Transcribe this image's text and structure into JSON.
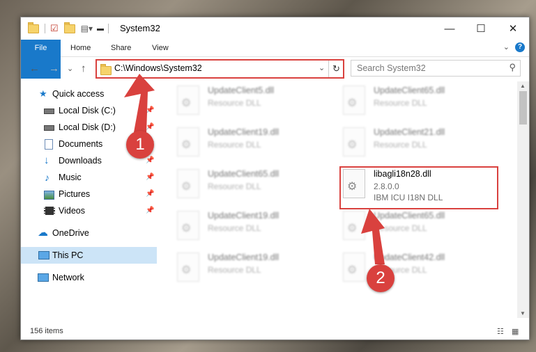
{
  "window": {
    "title": "System32",
    "controls": {
      "minimize": "—",
      "maximize": "☐",
      "close": "✕"
    }
  },
  "ribbon": {
    "tabs": [
      {
        "label": "File"
      },
      {
        "label": "Home"
      },
      {
        "label": "Share"
      },
      {
        "label": "View"
      }
    ],
    "help": "?"
  },
  "nav": {
    "back": "←",
    "forward": "→",
    "recent": "⌄",
    "up": "↑",
    "address": "C:\\Windows\\System32",
    "search_placeholder": "Search System32"
  },
  "sidebar": {
    "items": [
      {
        "label": "Quick access",
        "icon": "star-icon"
      },
      {
        "label": "Local Disk (C:)",
        "icon": "drive-icon",
        "pinned": true
      },
      {
        "label": "Local Disk (D:)",
        "icon": "drive-icon",
        "pinned": true
      },
      {
        "label": "Documents",
        "icon": "documents-icon",
        "pinned": true
      },
      {
        "label": "Downloads",
        "icon": "downloads-icon",
        "pinned": true
      },
      {
        "label": "Music",
        "icon": "music-icon",
        "pinned": true
      },
      {
        "label": "Pictures",
        "icon": "pictures-icon",
        "pinned": true
      },
      {
        "label": "Videos",
        "icon": "videos-icon",
        "pinned": true
      },
      {
        "label": "OneDrive",
        "icon": "onedrive-icon"
      },
      {
        "label": "This PC",
        "icon": "computer-icon",
        "selected": true
      },
      {
        "label": "Network",
        "icon": "network-icon"
      }
    ]
  },
  "files": [
    {
      "name": "UpdateClient5.dll",
      "desc1": "Resource DLL",
      "desc2": ""
    },
    {
      "name": "UpdateClient65.dll",
      "desc1": "Resource DLL",
      "desc2": ""
    },
    {
      "name": "UpdateClient19.dll",
      "desc1": "Resource DLL",
      "desc2": ""
    },
    {
      "name": "UpdateClient21.dll",
      "desc1": "Resource DLL",
      "desc2": ""
    },
    {
      "name": "UpdateClient65.dll",
      "desc1": "Resource DLL",
      "desc2": ""
    },
    {
      "name": "libagli18n28.dll",
      "desc1": "2.8.0.0",
      "desc2": "IBM ICU I18N DLL"
    },
    {
      "name": "UpdateClient19.dll",
      "desc1": "Resource DLL",
      "desc2": ""
    },
    {
      "name": "UpdateClient65.dll",
      "desc1": "Resource DLL",
      "desc2": ""
    },
    {
      "name": "UpdateClient19.dll",
      "desc1": "Resource DLL",
      "desc2": ""
    },
    {
      "name": "UpdateClient42.dll",
      "desc1": "Resource DLL",
      "desc2": ""
    }
  ],
  "status": {
    "item_count": "156 items"
  },
  "annotations": {
    "step1": "1",
    "step2": "2",
    "color": "#d9413e"
  }
}
